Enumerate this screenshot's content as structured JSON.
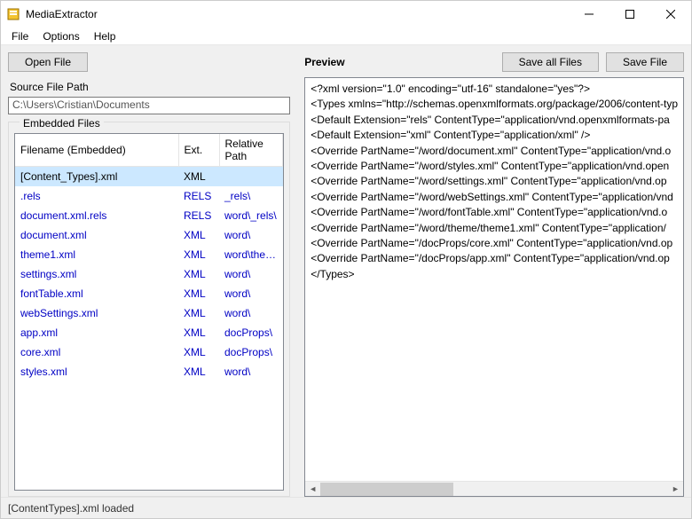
{
  "app": {
    "title": "MediaExtractor"
  },
  "menubar": [
    "File",
    "Options",
    "Help"
  ],
  "buttons": {
    "open_file": "Open File",
    "save_all": "Save all Files",
    "save_file": "Save File"
  },
  "labels": {
    "source_file_path": "Source File Path",
    "embedded_files": "Embedded Files",
    "preview": "Preview"
  },
  "source_path": "C:\\Users\\Cristian\\Documents",
  "table": {
    "headers": {
      "filename": "Filename (Embedded)",
      "ext": "Ext.",
      "relpath": "Relative Path"
    },
    "rows": [
      {
        "filename": "[Content_Types].xml",
        "ext": "XML",
        "relpath": "",
        "selected": true
      },
      {
        "filename": ".rels",
        "ext": "RELS",
        "relpath": "_rels\\"
      },
      {
        "filename": "document.xml.rels",
        "ext": "RELS",
        "relpath": "word\\_rels\\"
      },
      {
        "filename": "document.xml",
        "ext": "XML",
        "relpath": "word\\"
      },
      {
        "filename": "theme1.xml",
        "ext": "XML",
        "relpath": "word\\theme\\"
      },
      {
        "filename": "settings.xml",
        "ext": "XML",
        "relpath": "word\\"
      },
      {
        "filename": "fontTable.xml",
        "ext": "XML",
        "relpath": "word\\"
      },
      {
        "filename": "webSettings.xml",
        "ext": "XML",
        "relpath": "word\\"
      },
      {
        "filename": "app.xml",
        "ext": "XML",
        "relpath": "docProps\\"
      },
      {
        "filename": "core.xml",
        "ext": "XML",
        "relpath": "docProps\\"
      },
      {
        "filename": "styles.xml",
        "ext": "XML",
        "relpath": "word\\"
      }
    ]
  },
  "preview_lines": [
    "<?xml version=\"1.0\" encoding=\"utf-16\" standalone=\"yes\"?>",
    "<Types xmlns=\"http://schemas.openxmlformats.org/package/2006/content-typ",
    "  <Default Extension=\"rels\" ContentType=\"application/vnd.openxmlformats-pa",
    "  <Default Extension=\"xml\" ContentType=\"application/xml\" />",
    "  <Override PartName=\"/word/document.xml\" ContentType=\"application/vnd.o",
    "  <Override PartName=\"/word/styles.xml\" ContentType=\"application/vnd.open",
    "  <Override PartName=\"/word/settings.xml\" ContentType=\"application/vnd.op",
    "  <Override PartName=\"/word/webSettings.xml\" ContentType=\"application/vnd",
    "  <Override PartName=\"/word/fontTable.xml\" ContentType=\"application/vnd.o",
    "  <Override PartName=\"/word/theme/theme1.xml\" ContentType=\"application/",
    "  <Override PartName=\"/docProps/core.xml\" ContentType=\"application/vnd.op",
    "  <Override PartName=\"/docProps/app.xml\" ContentType=\"application/vnd.op",
    "</Types>"
  ],
  "statusbar": "[ContentTypes].xml loaded"
}
